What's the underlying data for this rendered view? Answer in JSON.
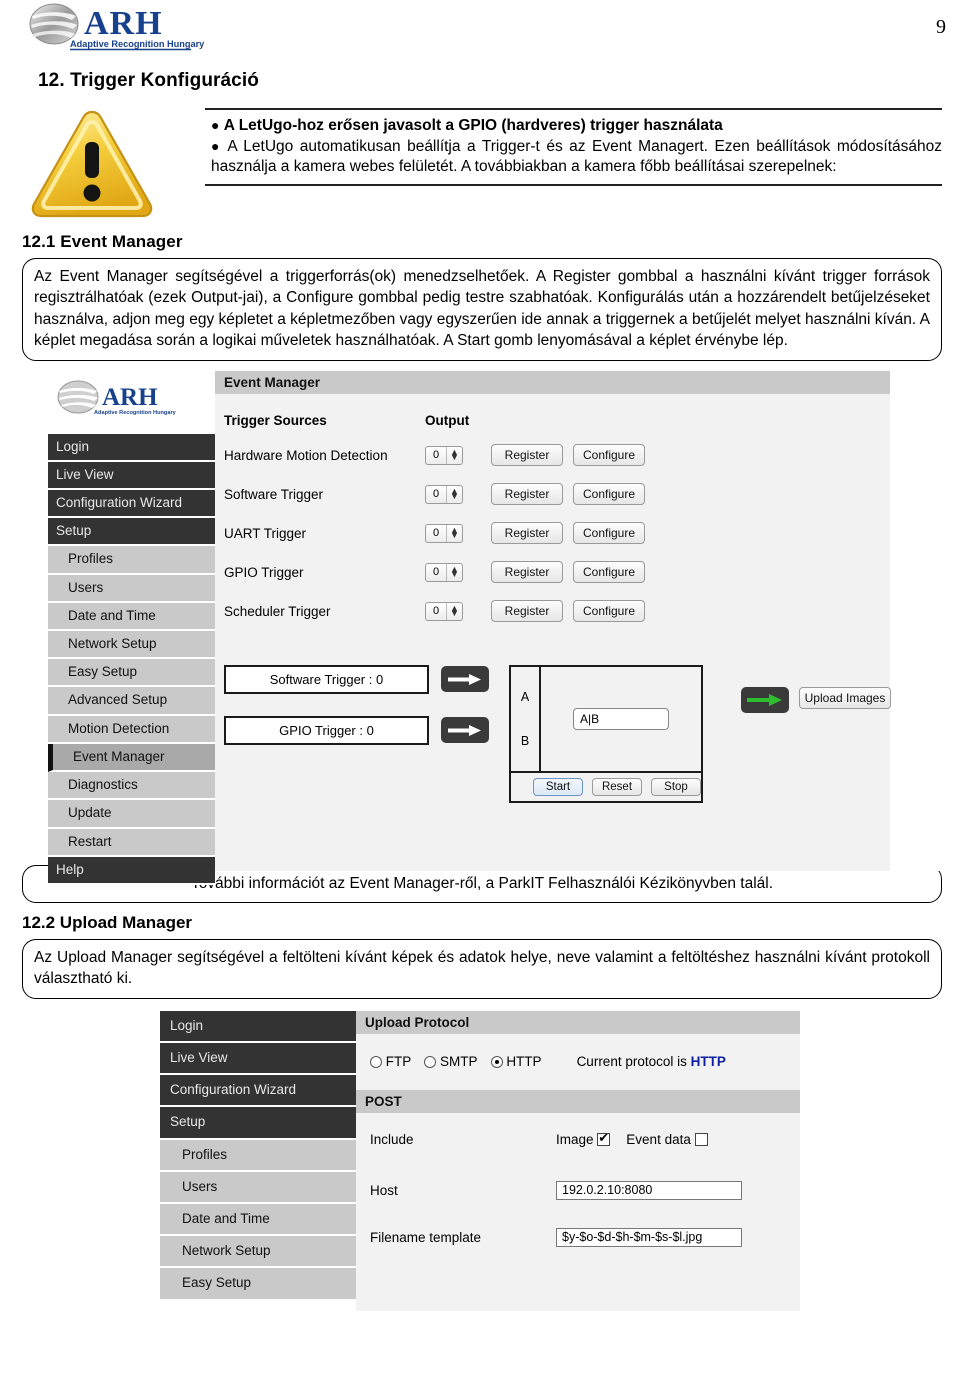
{
  "header": {
    "page_number": "9",
    "logo_title": "ARH",
    "logo_subtitle": "Adaptive Recognition Hungary"
  },
  "section": {
    "heading": "12. Trigger Konfiguráció",
    "warning": {
      "icon": "warning-triangle-icon",
      "bullet1": "A LetUgo-hoz erősen javasolt a GPIO (hardveres) trigger használata",
      "bullet2": "A LetUgo automatikusan beállítja a Trigger-t és az Event Managert. Ezen beállítások módosításához használja a kamera webes felületét. A továbbiakban a kamera főbb beállításai szerepelnek:",
      "bullet2_bold_word": "főbb",
      "bullet1_tail": "ta"
    }
  },
  "event_manager": {
    "heading": "12.1 Event Manager",
    "description": "Az Event Manager segítségével a triggerforrás(ok) menedzselhetőek. A Register gombbal a használni kívánt trigger források regisztrálhatóak (ezek Output-jai), a Configure gombbal pedig testre szabhatóak. Konfigurálás után a hozzárendelt betűjelzéseket használva, adjon meg egy képletet a képletmezőben vagy egyszerűen ide annak a triggernek a betűjelét melyet használni kíván. A képlet megadása során a logikai műveletek használhatóak. A Start gomb lenyomásával a képlet érvénybe lép.",
    "caption": "További információt az Event Manager-ről, a ParkIT Felhasználói Kézikönyvben talál.",
    "panel_title": "Event Manager",
    "column_headers": {
      "sources": "Trigger Sources",
      "output": "Output"
    },
    "rows": [
      {
        "name": "Hardware Motion Detection",
        "output": "0",
        "register": "Register",
        "configure": "Configure"
      },
      {
        "name": "Software Trigger",
        "output": "0",
        "register": "Register",
        "configure": "Configure"
      },
      {
        "name": "UART Trigger",
        "output": "0",
        "register": "Register",
        "configure": "Configure"
      },
      {
        "name": "GPIO Trigger",
        "output": "0",
        "register": "Register",
        "configure": "Configure"
      },
      {
        "name": "Scheduler Trigger",
        "output": "0",
        "register": "Register",
        "configure": "Configure"
      }
    ],
    "registered": [
      {
        "label": "Software Trigger : 0",
        "letter": "A"
      },
      {
        "label": "GPIO Trigger : 0",
        "letter": "B"
      }
    ],
    "formula_value": "A|B",
    "controls": {
      "start": "Start",
      "reset": "Reset",
      "stop": "Stop"
    },
    "upload_images_button": "Upload Images",
    "sidebar": [
      {
        "label": "Login",
        "level": "top",
        "state": "normal"
      },
      {
        "label": "Live View",
        "level": "top",
        "state": "normal"
      },
      {
        "label": "Configuration Wizard",
        "level": "top",
        "state": "normal"
      },
      {
        "label": "Setup",
        "level": "top",
        "state": "normal"
      },
      {
        "label": "Profiles",
        "level": "sub",
        "state": "normal"
      },
      {
        "label": "Users",
        "level": "sub",
        "state": "normal"
      },
      {
        "label": "Date and Time",
        "level": "sub",
        "state": "normal"
      },
      {
        "label": "Network Setup",
        "level": "sub",
        "state": "normal"
      },
      {
        "label": "Easy Setup",
        "level": "sub",
        "state": "normal"
      },
      {
        "label": "Advanced Setup",
        "level": "sub",
        "state": "normal"
      },
      {
        "label": "Motion Detection",
        "level": "sub",
        "state": "normal"
      },
      {
        "label": "Event Manager",
        "level": "sub",
        "state": "active"
      },
      {
        "label": "Diagnostics",
        "level": "sub",
        "state": "normal"
      },
      {
        "label": "Update",
        "level": "sub",
        "state": "normal"
      },
      {
        "label": "Restart",
        "level": "sub",
        "state": "normal"
      },
      {
        "label": "Help",
        "level": "top",
        "state": "normal"
      }
    ]
  },
  "upload_manager": {
    "heading": "12.2 Upload Manager",
    "description": "Az Upload Manager segítségével a feltölteni kívánt képek és adatok helye, neve valamint a feltöltéshez használni kívánt protokoll választható ki.",
    "panel_title": "Upload Protocol",
    "protocols": [
      {
        "label": "FTP",
        "selected": false
      },
      {
        "label": "SMTP",
        "selected": false
      },
      {
        "label": "HTTP",
        "selected": true
      }
    ],
    "current_protocol_prefix": "Current protocol is",
    "current_protocol": "HTTP",
    "post_title": "POST",
    "include_label": "Include",
    "include_options": [
      {
        "label": "Image",
        "checked": true
      },
      {
        "label": "Event data",
        "checked": false
      }
    ],
    "host_label": "Host",
    "host_value": "192.0.2.10:8080",
    "filename_label": "Filename template",
    "filename_value": "$y-$o-$d-$h-$m-$s-$l.jpg",
    "sidebar": [
      {
        "label": "Login",
        "level": "top"
      },
      {
        "label": "Live View",
        "level": "top"
      },
      {
        "label": "Configuration Wizard",
        "level": "top"
      },
      {
        "label": "Setup",
        "level": "top"
      },
      {
        "label": "Profiles",
        "level": "sub"
      },
      {
        "label": "Users",
        "level": "sub"
      },
      {
        "label": "Date and Time",
        "level": "sub"
      },
      {
        "label": "Network Setup",
        "level": "sub"
      },
      {
        "label": "Easy Setup",
        "level": "sub"
      }
    ]
  },
  "colors": {
    "brand_blue": "#17418c",
    "nav_dark": "#333333",
    "nav_sub": "#c9c9c9",
    "nav_active": "#a9a9a9",
    "panel_header": "#c9c9c9",
    "panel_body": "#f2f2f2",
    "link_blue": "#0b1fa0",
    "arrow_green": "#2fbe2f",
    "warning_yellow": "#f2c72e"
  }
}
